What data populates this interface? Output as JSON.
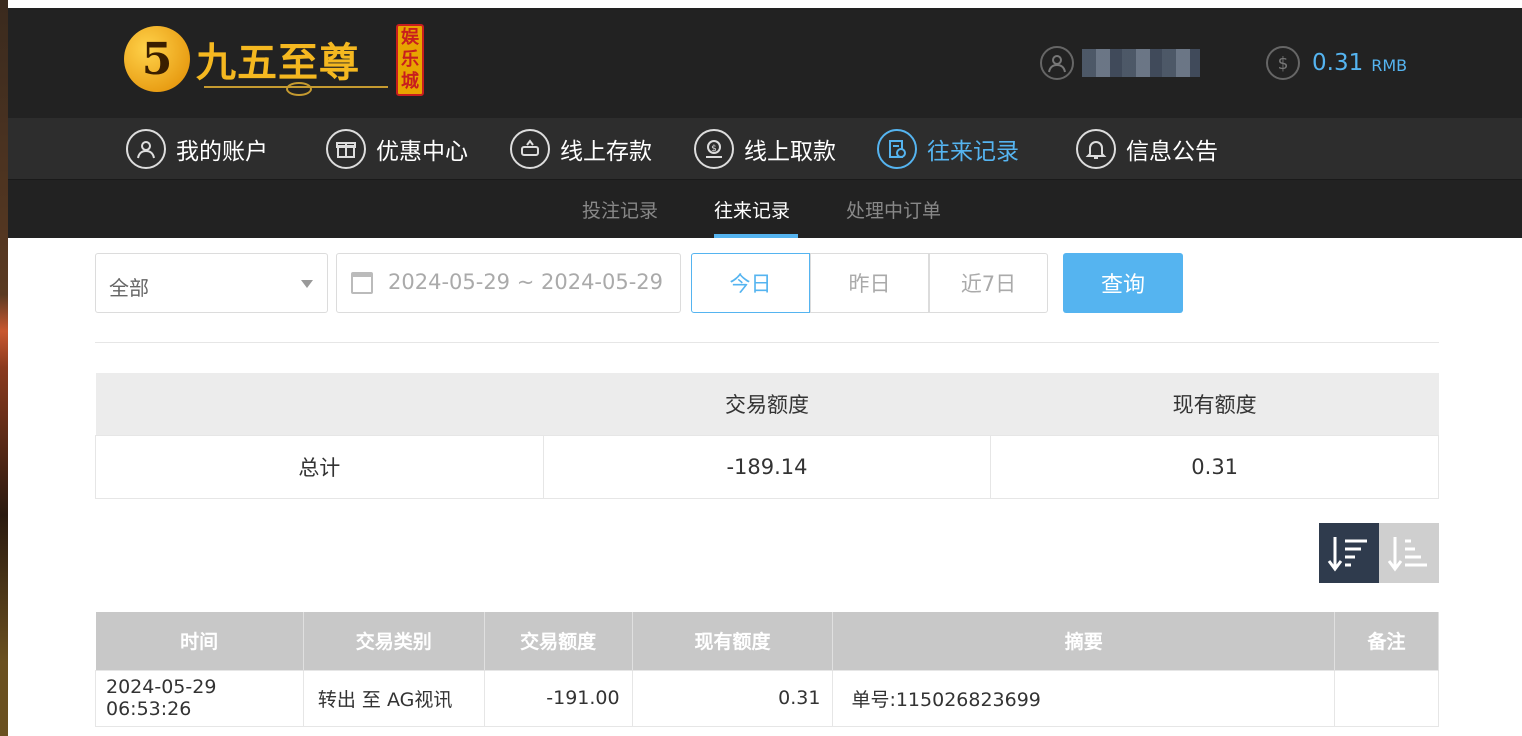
{
  "logo": {
    "digit": "5",
    "name": "九五至尊",
    "sub": [
      "娱",
      "乐",
      "城"
    ]
  },
  "account": {
    "balance": "0.31",
    "currency": "RMB"
  },
  "main_nav": [
    {
      "label": "我的账户",
      "icon": "user-icon"
    },
    {
      "label": "优惠中心",
      "icon": "gift-icon"
    },
    {
      "label": "线上存款",
      "icon": "deposit-icon"
    },
    {
      "label": "线上取款",
      "icon": "withdraw-icon"
    },
    {
      "label": "往来记录",
      "icon": "records-icon",
      "active": true
    },
    {
      "label": "信息公告",
      "icon": "bell-icon"
    }
  ],
  "sub_nav": [
    {
      "label": "投注记录"
    },
    {
      "label": "往来记录",
      "active": true
    },
    {
      "label": "处理中订单"
    }
  ],
  "filter": {
    "type_value": "全部",
    "date_range": "2024-05-29 ~ 2024-05-29",
    "quick_ranges": [
      "今日",
      "昨日",
      "近7日"
    ],
    "query_label": "查询"
  },
  "summary": {
    "headers": [
      "",
      "交易额度",
      "现有额度"
    ],
    "row": [
      "总计",
      "-189.14",
      "0.31"
    ]
  },
  "records": {
    "headers": [
      "时间",
      "交易类别",
      "交易额度",
      "现有额度",
      "摘要",
      "备注"
    ],
    "rows": [
      [
        "2024-05-29 06:53:26",
        "转出 至 AG视讯",
        "-191.00",
        "0.31",
        "单号:115026823699",
        ""
      ]
    ]
  },
  "colors": {
    "accent": "#55b4f0",
    "header_bg": "#222222",
    "gold": "#f5b820"
  }
}
